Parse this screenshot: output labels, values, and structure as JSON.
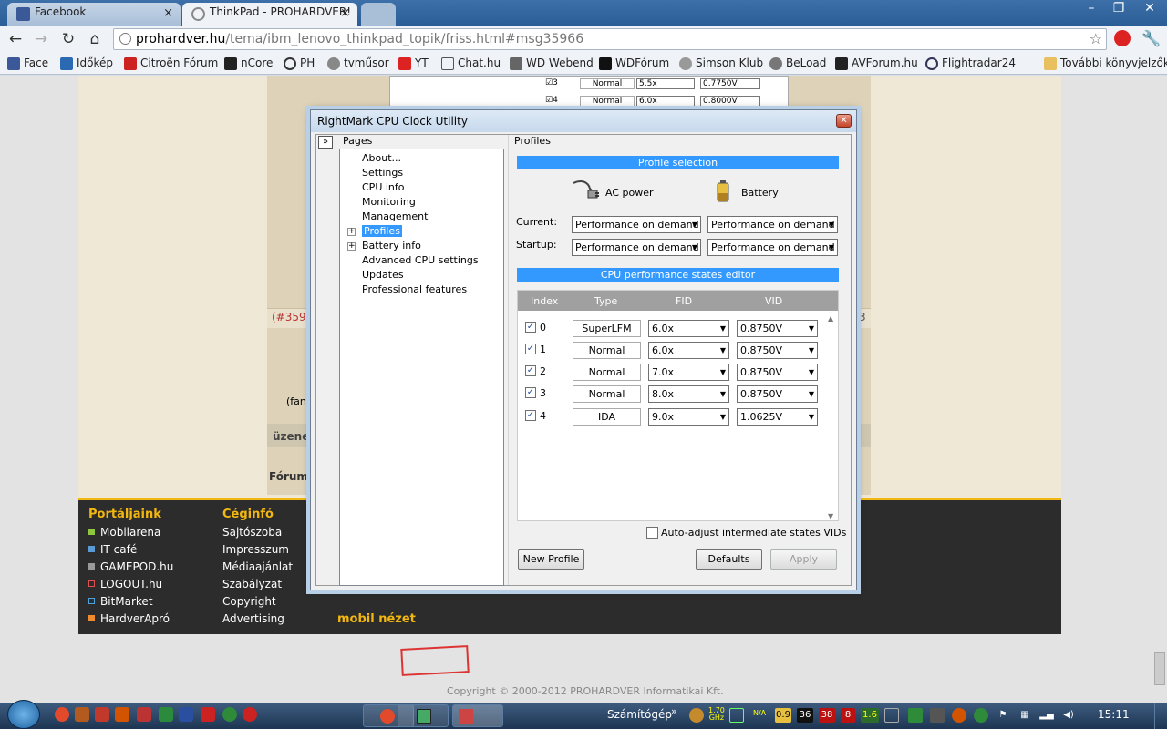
{
  "browser": {
    "tabs": [
      {
        "label": "Facebook"
      },
      {
        "label": "ThinkPad - PROHARDVER!"
      }
    ],
    "url": {
      "host": "prohardver.hu",
      "path": "/tema/ibm_lenovo_thinkpad_topik/friss.html#msg35966"
    },
    "bookmarks": [
      "Face",
      "Időkép",
      "Citroën Fórum",
      "nCore",
      "PH",
      "tvműsor",
      "YT",
      "Chat.hu",
      "WD Webend",
      "WDFórum",
      "Simson Klub",
      "BeLoad",
      "AVForum.hu",
      "Flightradar24"
    ],
    "other_bookmarks": "További könyvjelzők"
  },
  "page": {
    "fragment_msg": "(#3596",
    "fragment_num": "3",
    "fragment_x": "x",
    "fragment_fana": "(fana",
    "fragment_uzenet": "üzenet",
    "fragment_forumo": "Fórumo",
    "footer": {
      "col1_title": "Portáljaink",
      "col1": [
        {
          "label": "Mobilarena",
          "color": "#8ec640"
        },
        {
          "label": "IT café",
          "color": "#5a9bd5"
        },
        {
          "label": "GAMEPOD.hu",
          "color": "#999999"
        },
        {
          "label": "LOGOUT.hu",
          "color": "#e05050"
        },
        {
          "label": "BitMarket",
          "color": "#4aa3df"
        },
        {
          "label": "HardverApró",
          "color": "#f08a30"
        }
      ],
      "col2_title": "Céginfó",
      "col2": [
        "Sajtószoba",
        "Impresszum",
        "Médiaajánlat",
        "Szabályzat",
        "Copyright",
        "Advertising"
      ],
      "mobile": "mobil nézet"
    },
    "copyright": "Copyright © 2000-2012 PROHARDVER Informatikai Kft."
  },
  "bg_table": {
    "rows": [
      {
        "index": "3",
        "type": "Normal",
        "fid": "5.5x",
        "vid": "0.7750V"
      },
      {
        "index": "4",
        "type": "Normal",
        "fid": "6.0x",
        "vid": "0.8000V"
      }
    ]
  },
  "dialog": {
    "title": "RightMark CPU Clock Utility",
    "pages_label": "Pages",
    "tree": [
      "About...",
      "Settings",
      "CPU info",
      "Monitoring",
      "Management",
      "Profiles",
      "Battery info",
      "Advanced CPU settings",
      "Updates",
      "Professional features"
    ],
    "profiles_label": "Profiles",
    "profile_selection": "Profile selection",
    "ac_power": "AC power",
    "battery": "Battery",
    "current_label": "Current:",
    "startup_label": "Startup:",
    "current_ac": "Performance on demand",
    "current_bat": "Performance on demand",
    "startup_ac": "Performance on demand",
    "startup_bat": "Performance on demand",
    "states_editor": "CPU performance states editor",
    "columns": [
      "Index",
      "Type",
      "FID",
      "VID"
    ],
    "states": [
      {
        "index": "0",
        "type": "SuperLFM",
        "fid": "6.0x",
        "vid": "0.8750V",
        "checked": true
      },
      {
        "index": "1",
        "type": "Normal",
        "fid": "6.0x",
        "vid": "0.8750V",
        "checked": true
      },
      {
        "index": "2",
        "type": "Normal",
        "fid": "7.0x",
        "vid": "0.8750V",
        "checked": true
      },
      {
        "index": "3",
        "type": "Normal",
        "fid": "8.0x",
        "vid": "0.8750V",
        "checked": true
      },
      {
        "index": "4",
        "type": "IDA",
        "fid": "9.0x",
        "vid": "1.0625V",
        "checked": true
      }
    ],
    "auto_adjust": "Auto-adjust intermediate states VIDs",
    "new_profile": "New Profile",
    "defaults": "Defaults",
    "apply": "Apply"
  },
  "taskbar": {
    "pc_label": "Számítógép",
    "cpu_freq_top": "1.70",
    "cpu_freq_bottom": "GHz",
    "na_label": "N/A",
    "tray_values": [
      "0.9",
      "36",
      "38",
      "8",
      "1.6"
    ],
    "clock": "15:11"
  }
}
